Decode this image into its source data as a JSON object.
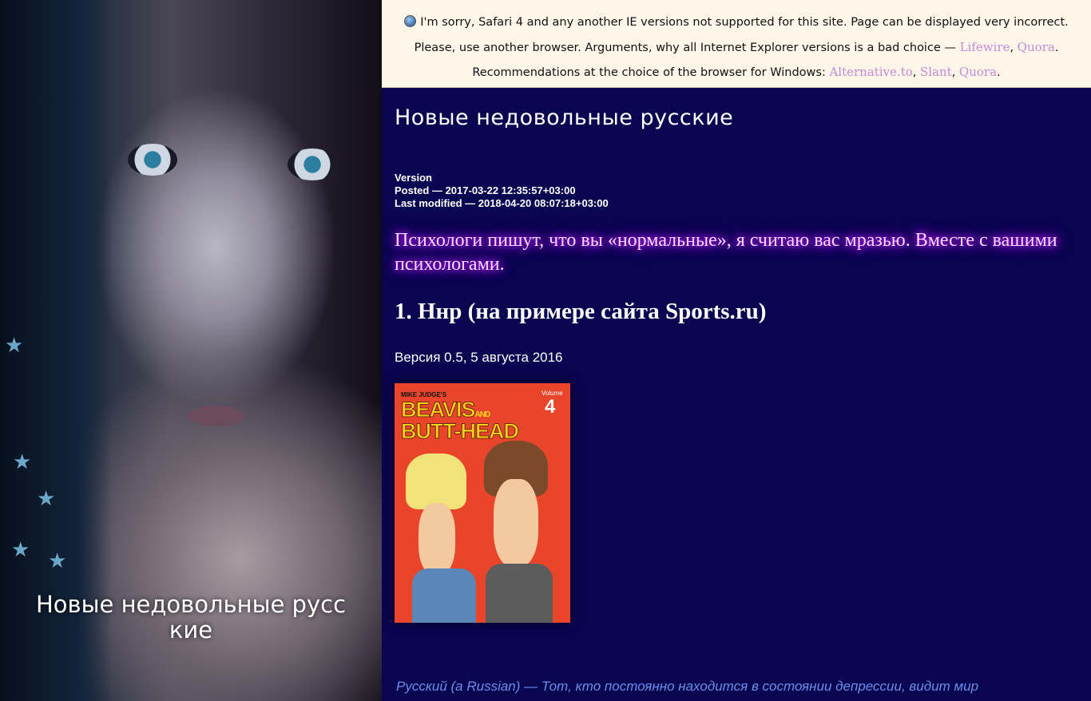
{
  "left_panel": {
    "title": "Новые недовольные русские"
  },
  "warning": {
    "line1": "I'm sorry, Safari 4 and any another IE versions not supported for this site. Page can be displayed very incorrect.",
    "line2_prefix": "Please, use another browser. Arguments, why all Internet Explorer versions is a bad choice — ",
    "line2_links": [
      "Lifewire",
      "Quora"
    ],
    "line3_prefix": "Recommendations at the choice of the browser for Windows: ",
    "line3_links": [
      "Alternative.to",
      "Slant",
      "Quora"
    ],
    "comma": ", ",
    "period": "."
  },
  "main": {
    "title": "Новые недовольные русские",
    "meta": {
      "version": "Version",
      "posted": "Posted — 2017-03-22 12:35:57+03:00",
      "modified": "Last modified — 2018-04-20 08:07:18+03:00"
    },
    "lead": "Психологи пишут, что вы «нормальные», я считаю вас мразью. Вместе с вашими психологами.",
    "section_heading": "1. Ннр (на примере сайта Sports.ru)",
    "version_line": "Версия 0.5, 5 августа 2016",
    "cover": {
      "small": "MIKE JUDGE'S",
      "title1": "BEAVIS",
      "title_and": "AND",
      "title2": "BUTT-HEAD",
      "volume_label": "Volume",
      "volume_number": "4"
    },
    "footer_quote": "Русский (a Russian) — Тот, кто постоянно находится в состоянии депрессии, видит мир"
  }
}
